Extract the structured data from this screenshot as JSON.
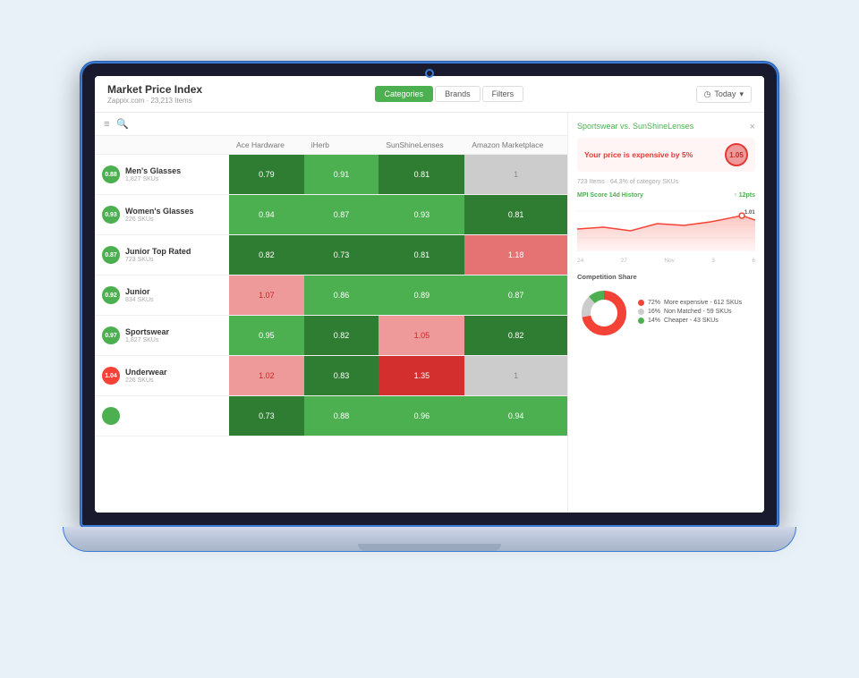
{
  "header": {
    "title": "Market Price Index",
    "subtitle": "Zappix.com · 23,213 Items",
    "tabs": [
      {
        "label": "Categories",
        "active": true
      },
      {
        "label": "Brands",
        "active": false
      },
      {
        "label": "Filters",
        "active": false
      }
    ],
    "date_label": "Today",
    "date_icon": "calendar-icon"
  },
  "toolbar": {
    "menu_icon": "≡",
    "search_icon": "🔍"
  },
  "table": {
    "columns": [
      "",
      "Ace Hardware",
      "iHerb",
      "SunShineLenses",
      "Amazon Marketplace"
    ],
    "rows": [
      {
        "badge": "0.88",
        "badge_color": "badge-green",
        "name": "Men's Glasses",
        "skus": "1,827 SKUs",
        "cells": [
          {
            "value": "0.79",
            "style": "green-dark"
          },
          {
            "value": "0.91",
            "style": "green-mid"
          },
          {
            "value": "0.81",
            "style": "green-dark"
          },
          {
            "value": "1",
            "style": "gray"
          }
        ]
      },
      {
        "badge": "0.93",
        "badge_color": "badge-green",
        "name": "Women's Glasses",
        "skus": "226 SKUs",
        "cells": [
          {
            "value": "0.94",
            "style": "green-mid"
          },
          {
            "value": "0.87",
            "style": "green-mid"
          },
          {
            "value": "0.93",
            "style": "green-mid"
          },
          {
            "value": "0.81",
            "style": "green-dark"
          }
        ]
      },
      {
        "badge": "0.87",
        "badge_color": "badge-green",
        "name": "Junior Top Rated",
        "skus": "723 SKUs",
        "cells": [
          {
            "value": "0.82",
            "style": "green-dark"
          },
          {
            "value": "0.73",
            "style": "green-dark"
          },
          {
            "value": "0.81",
            "style": "green-dark"
          },
          {
            "value": "1.18",
            "style": "red-mid"
          }
        ]
      },
      {
        "badge": "0.92",
        "badge_color": "badge-green",
        "name": "Junior",
        "skus": "834 SKUs",
        "cells": [
          {
            "value": "1.07",
            "style": "red-light"
          },
          {
            "value": "0.86",
            "style": "green-mid"
          },
          {
            "value": "0.89",
            "style": "green-mid"
          },
          {
            "value": "0.87",
            "style": "green-mid"
          }
        ]
      },
      {
        "badge": "0.97",
        "badge_color": "badge-green",
        "name": "Sportswear",
        "skus": "1,827 SKUs",
        "cells": [
          {
            "value": "0.95",
            "style": "green-mid"
          },
          {
            "value": "0.82",
            "style": "green-dark"
          },
          {
            "value": "1.05",
            "style": "red-light"
          },
          {
            "value": "0.82",
            "style": "green-dark"
          }
        ]
      },
      {
        "badge": "1.04",
        "badge_color": "badge-red",
        "name": "Underwear",
        "skus": "226 SKUs",
        "cells": [
          {
            "value": "1.02",
            "style": "red-light"
          },
          {
            "value": "0.83",
            "style": "green-dark"
          },
          {
            "value": "1.35",
            "style": "red-strong"
          },
          {
            "value": "1",
            "style": "gray"
          }
        ]
      },
      {
        "badge": "",
        "badge_color": "badge-green",
        "name": "",
        "skus": "",
        "cells": [
          {
            "value": "0.73",
            "style": "green-dark"
          },
          {
            "value": "0.88",
            "style": "green-mid"
          },
          {
            "value": "0.96",
            "style": "green-mid"
          },
          {
            "value": "0.94",
            "style": "green-mid"
          }
        ]
      }
    ]
  },
  "detail": {
    "title": "Sportswear",
    "vs": "vs. SunShineLenses",
    "close_label": "×",
    "price_alert": "Your price is expensive by 5%",
    "price_badge": "1.05",
    "subtitle": "723 Items · 64.3% of category SKUs",
    "mpi_history_label": "MPI Score 14d History",
    "mpi_change": "↑ 12pts",
    "mpi_value": "1.01",
    "chart_x_labels": [
      "24",
      "27",
      "Nov",
      "3",
      "6"
    ],
    "competition_label": "Competition Share",
    "legend": [
      {
        "color": "dot-red",
        "label": "More expensive - 612 SKUs",
        "pct": "72%"
      },
      {
        "color": "dot-gray",
        "label": "Non Matched - 59 SKUs",
        "pct": "16%"
      },
      {
        "color": "dot-green",
        "label": "Cheaper - 43 SKUs",
        "pct": "14%"
      }
    ],
    "donut": {
      "red_pct": 72,
      "gray_pct": 16,
      "green_pct": 14
    }
  }
}
